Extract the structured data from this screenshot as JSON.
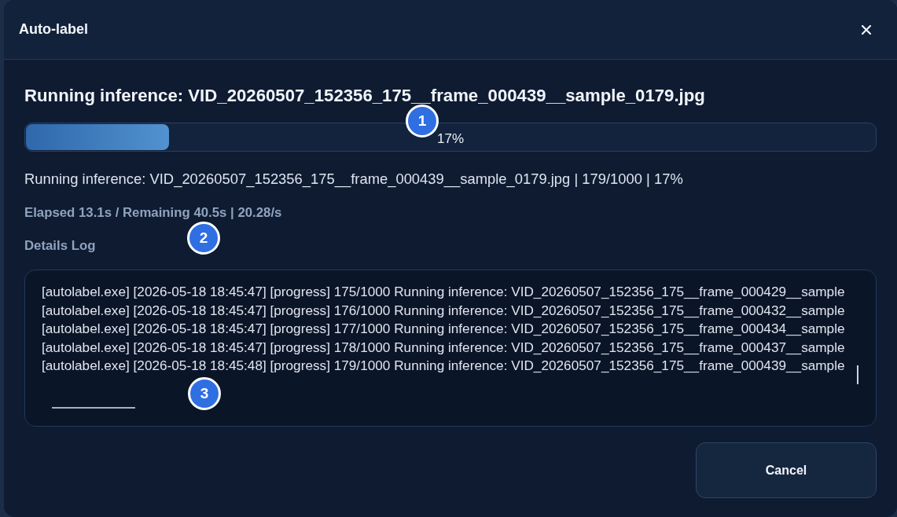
{
  "dialog": {
    "title": "Auto-label"
  },
  "heading": "Running inference: VID_20260507_152356_175__frame_000439__sample_0179.jpg",
  "progress": {
    "level": 0.17,
    "label": "17%",
    "marker": "1"
  },
  "status_line": "Running inference: VID_20260507_152356_175__frame_000439__sample_0179.jpg | 179/1000 | 17%",
  "timing": {
    "text": "Elapsed 13.1s / Remaining 40.5s | 20.28/s",
    "marker": "2"
  },
  "log": {
    "title": "Details Log",
    "marker": "3",
    "lines": [
      "[autolabel.exe] [2026-05-18 18:45:47] [progress] 175/1000 Running inference: VID_20260507_152356_175__frame_000429__sample",
      "[autolabel.exe] [2026-05-18 18:45:47] [progress] 176/1000 Running inference: VID_20260507_152356_175__frame_000432__sample",
      "[autolabel.exe] [2026-05-18 18:45:47] [progress] 177/1000 Running inference: VID_20260507_152356_175__frame_000434__sample",
      "[autolabel.exe] [2026-05-18 18:45:47] [progress] 178/1000 Running inference: VID_20260507_152356_175__frame_000437__sample",
      "[autolabel.exe] [2026-05-18 18:45:48] [progress] 179/1000 Running inference: VID_20260507_152356_175__frame_000439__sample"
    ]
  },
  "buttons": [
    {
      "label": "Cancel"
    }
  ]
}
